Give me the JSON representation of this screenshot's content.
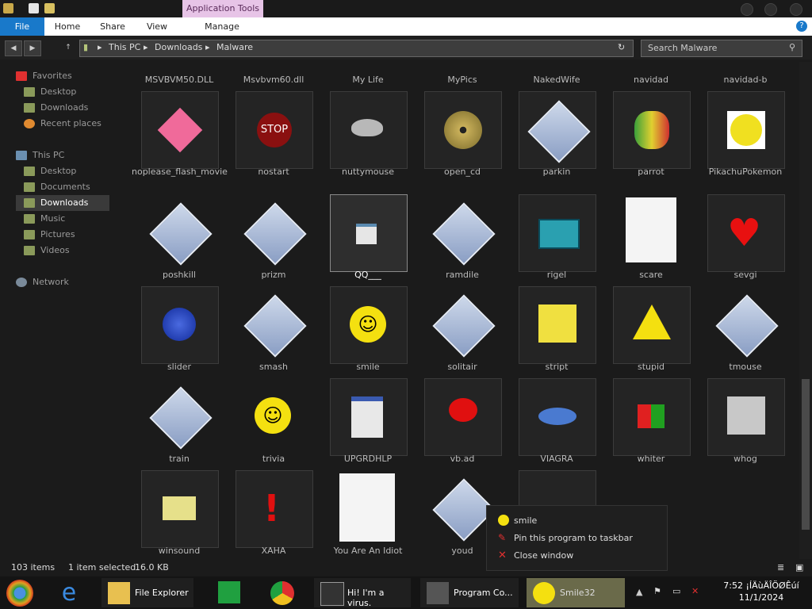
{
  "ribbon": {
    "context_tab": "Application Tools",
    "tabs": [
      "File",
      "Home",
      "Share",
      "View",
      "Manage"
    ]
  },
  "address": {
    "crumbs": [
      "This PC",
      "Downloads",
      "Malware"
    ],
    "search_placeholder": "Search Malware"
  },
  "sidebar": {
    "items": [
      {
        "label": "Favorites",
        "icon": "heart-icon"
      },
      {
        "label": "Desktop",
        "icon": "folder-icon"
      },
      {
        "label": "Downloads",
        "icon": "folder-icon"
      },
      {
        "label": "Recent places",
        "icon": "recent-places-icon"
      },
      {
        "label": "This PC",
        "icon": "computer-icon"
      },
      {
        "label": "Desktop",
        "icon": "folder-icon"
      },
      {
        "label": "Documents",
        "icon": "folder-icon"
      },
      {
        "label": "Downloads",
        "icon": "folder-icon"
      },
      {
        "label": "Music",
        "icon": "folder-icon"
      },
      {
        "label": "Pictures",
        "icon": "folder-icon"
      },
      {
        "label": "Videos",
        "icon": "folder-icon"
      },
      {
        "label": "Network",
        "icon": "network-icon"
      }
    ]
  },
  "files": {
    "top_row": [
      "MSVBVM50.DLL",
      "Msvbvm60.dll",
      "My Life",
      "MyPics",
      "NakedWife",
      "navidad",
      "navidad-b"
    ],
    "grid": [
      [
        "noplease_flash_movie",
        "nostart",
        "nuttymouse",
        "open_cd",
        "parkin",
        "parrot",
        "PikachuPokemon"
      ],
      [
        "poshkill",
        "prizm",
        "QQ___",
        "ramdile",
        "rigel",
        "scare",
        "sevgi"
      ],
      [
        "slider",
        "smash",
        "smile",
        "solitair",
        "stript",
        "stupid",
        "tmouse"
      ],
      [
        "train",
        "trivia",
        "UPGRDHLP",
        "vb.ad",
        "VIAGRA",
        "whiter",
        "whog"
      ],
      [
        "winsound",
        "XAHA",
        "You Are An Idiot",
        "youd",
        "",
        ""
      ]
    ]
  },
  "status": {
    "items": "103 items",
    "selected": "1 item selected",
    "size": "16.0 KB"
  },
  "context_menu": {
    "items": [
      "smile",
      "Pin this program to taskbar",
      "Close window"
    ]
  },
  "taskbar": {
    "buttons": [
      "File Explorer",
      "Hi! I'm a virus.",
      "Program Co...",
      "Smile32"
    ],
    "time": "7:52 ¡ÍÄùÄÎÖØÊúí",
    "date": "11/1/2024"
  }
}
